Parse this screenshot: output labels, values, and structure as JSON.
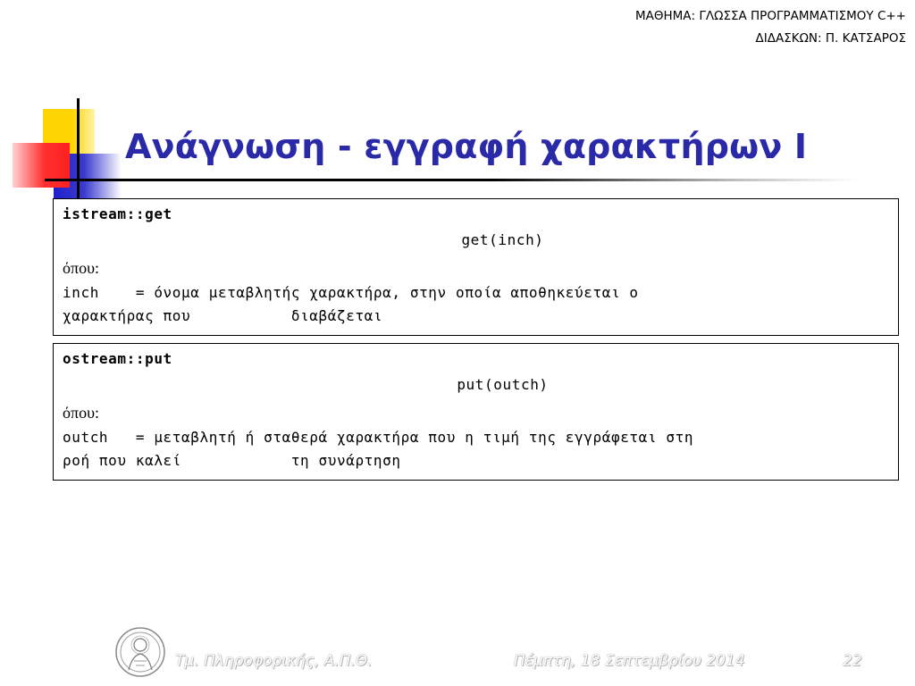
{
  "header": {
    "course": "ΜΑΘΗΜΑ: ΓΛΩΣΣΑ ΠΡΟΓΡΑΜΜΑΤΙΣΜΟΥ C++",
    "instructor": "ΔΙΔΑΣΚΩΝ: Π. ΚΑΤΣΑΡΟΣ"
  },
  "slide": {
    "title": "Ανάγνωση - εγγραφή χαρακτήρων Ι"
  },
  "boxes": [
    {
      "name": "istream::get",
      "signature": "get(inch)",
      "where": "όπου:",
      "description": "inch    = όνομα μεταβλητής χαρακτήρα, στην οποία αποθηκεύεται ο\nχαρακτήρας που           διαβάζεται"
    },
    {
      "name": "ostream::put",
      "signature": "put(outch)",
      "where": "όπου:",
      "description": "outch   = μεταβλητή ή σταθερά χαρακτήρα που η τιμή της εγγράφεται στη\nροή που καλεί            τη συνάρτηση"
    }
  ],
  "footer": {
    "department": "Τμ. Πληροφορικής, Α.Π.Θ.",
    "date": "Πέμπτη, 18 Σεπτεμβρίου 2014",
    "page": "22"
  },
  "colors": {
    "title": "#2a2aa8",
    "deco_yellow": "#ffd400",
    "deco_blue": "#2020cc",
    "deco_red": "#ff2020"
  },
  "icons": {
    "footer_logo": "university-seal-icon"
  }
}
